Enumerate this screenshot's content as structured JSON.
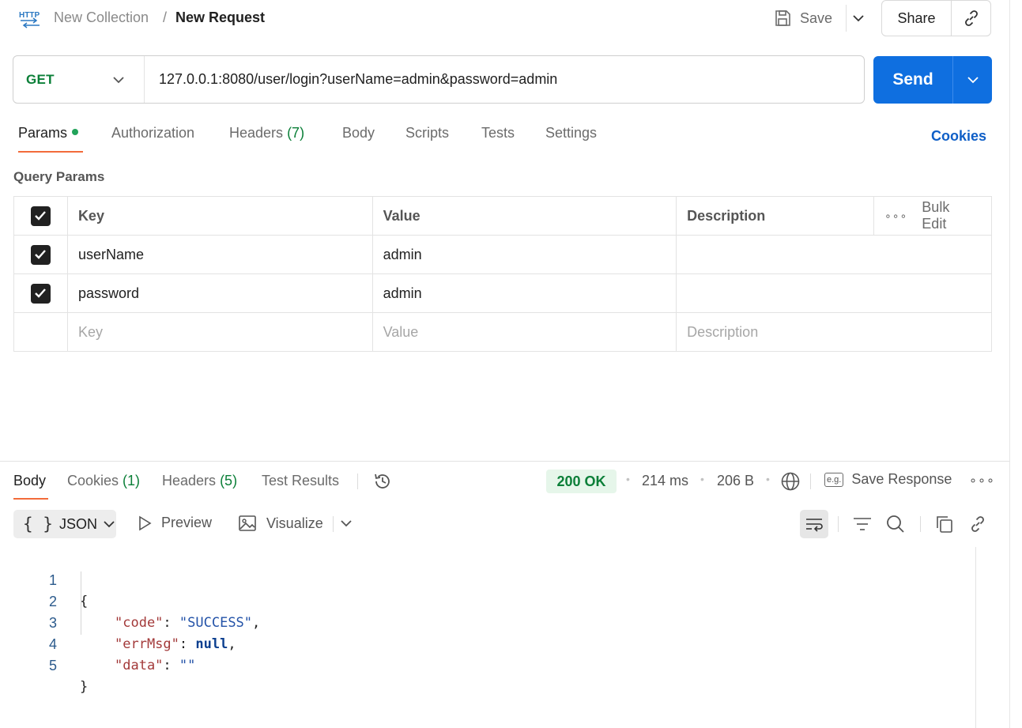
{
  "header": {
    "app_icon": "http-icon",
    "collection": "New Collection",
    "separator": "/",
    "request_name": "New Request",
    "save_label": "Save",
    "share_label": "Share"
  },
  "request": {
    "method": "GET",
    "url": "127.0.0.1:8080/user/login?userName=admin&password=admin",
    "send_label": "Send"
  },
  "request_tabs": {
    "params": "Params",
    "authorization": "Authorization",
    "headers": "Headers",
    "headers_count": "(7)",
    "body": "Body",
    "scripts": "Scripts",
    "tests": "Tests",
    "settings": "Settings",
    "cookies": "Cookies"
  },
  "query_params": {
    "title": "Query Params",
    "columns": {
      "key": "Key",
      "value": "Value",
      "description": "Description",
      "bulk_edit": "Bulk Edit"
    },
    "rows": [
      {
        "key": "userName",
        "value": "admin",
        "description": "",
        "checked": true
      },
      {
        "key": "password",
        "value": "admin",
        "description": "",
        "checked": true
      }
    ],
    "placeholder": {
      "key": "Key",
      "value": "Value",
      "description": "Description"
    }
  },
  "response_tabs": {
    "body": "Body",
    "cookies": "Cookies",
    "cookies_count": "(1)",
    "headers": "Headers",
    "headers_count": "(5)",
    "test_results": "Test Results"
  },
  "response_meta": {
    "status": "200 OK",
    "time": "214 ms",
    "size": "206 B",
    "save_response": "Save Response",
    "eg_label": "e.g."
  },
  "response_toolbar": {
    "format": "JSON",
    "format_braces": "{ }",
    "preview": "Preview",
    "visualize": "Visualize"
  },
  "response_body": {
    "line_numbers": [
      "1",
      "2",
      "3",
      "4",
      "5"
    ],
    "open_brace": "{",
    "close_brace": "}",
    "fields": [
      {
        "key": "\"code\"",
        "value": "\"SUCCESS\"",
        "type": "string",
        "trail": ","
      },
      {
        "key": "\"errMsg\"",
        "value": "null",
        "type": "null",
        "trail": ","
      },
      {
        "key": "\"data\"",
        "value": "\"\"",
        "type": "string",
        "trail": ""
      }
    ]
  },
  "colors": {
    "send_blue": "#0f6fe0",
    "method_green": "#0b7f38",
    "active_tab_orange": "#f26b3a",
    "status_bg": "#e6f6ea"
  }
}
